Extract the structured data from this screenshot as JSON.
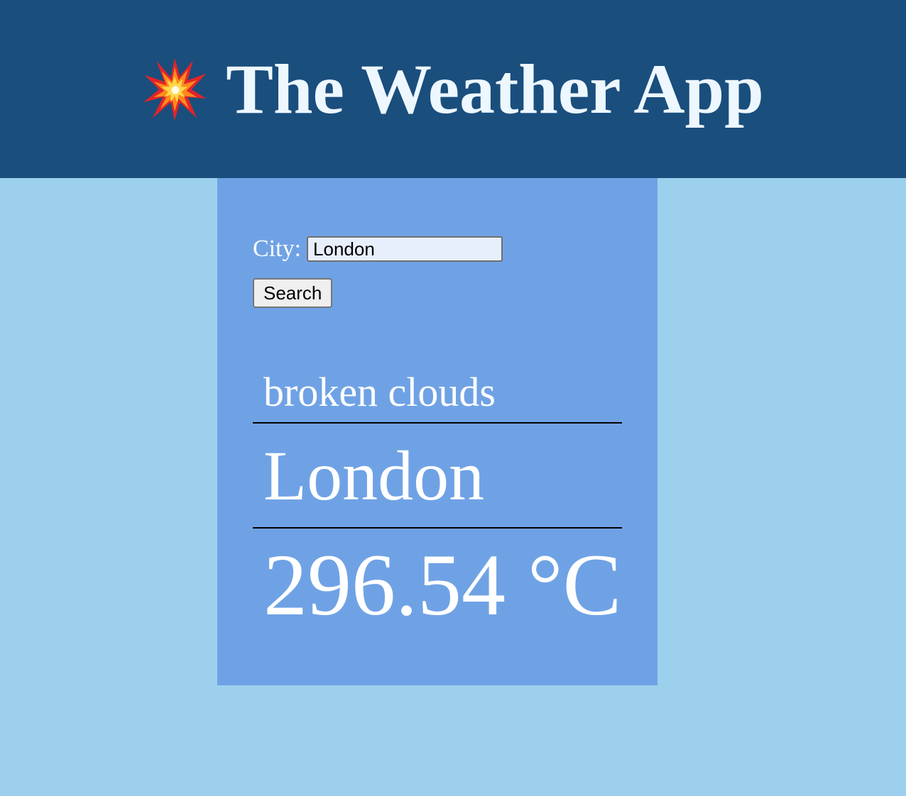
{
  "header": {
    "icon": "collision-burst-icon",
    "title": "The Weather App"
  },
  "search": {
    "label": "City:",
    "value": "London",
    "button_label": "Search"
  },
  "result": {
    "description": "broken clouds",
    "city": "London",
    "temperature": "296.54 °C"
  },
  "colors": {
    "header_bg": "#1a4e7d",
    "page_bg": "#9dd0ec",
    "card_bg": "#6fa2e5",
    "title_text": "#edf7ff"
  }
}
